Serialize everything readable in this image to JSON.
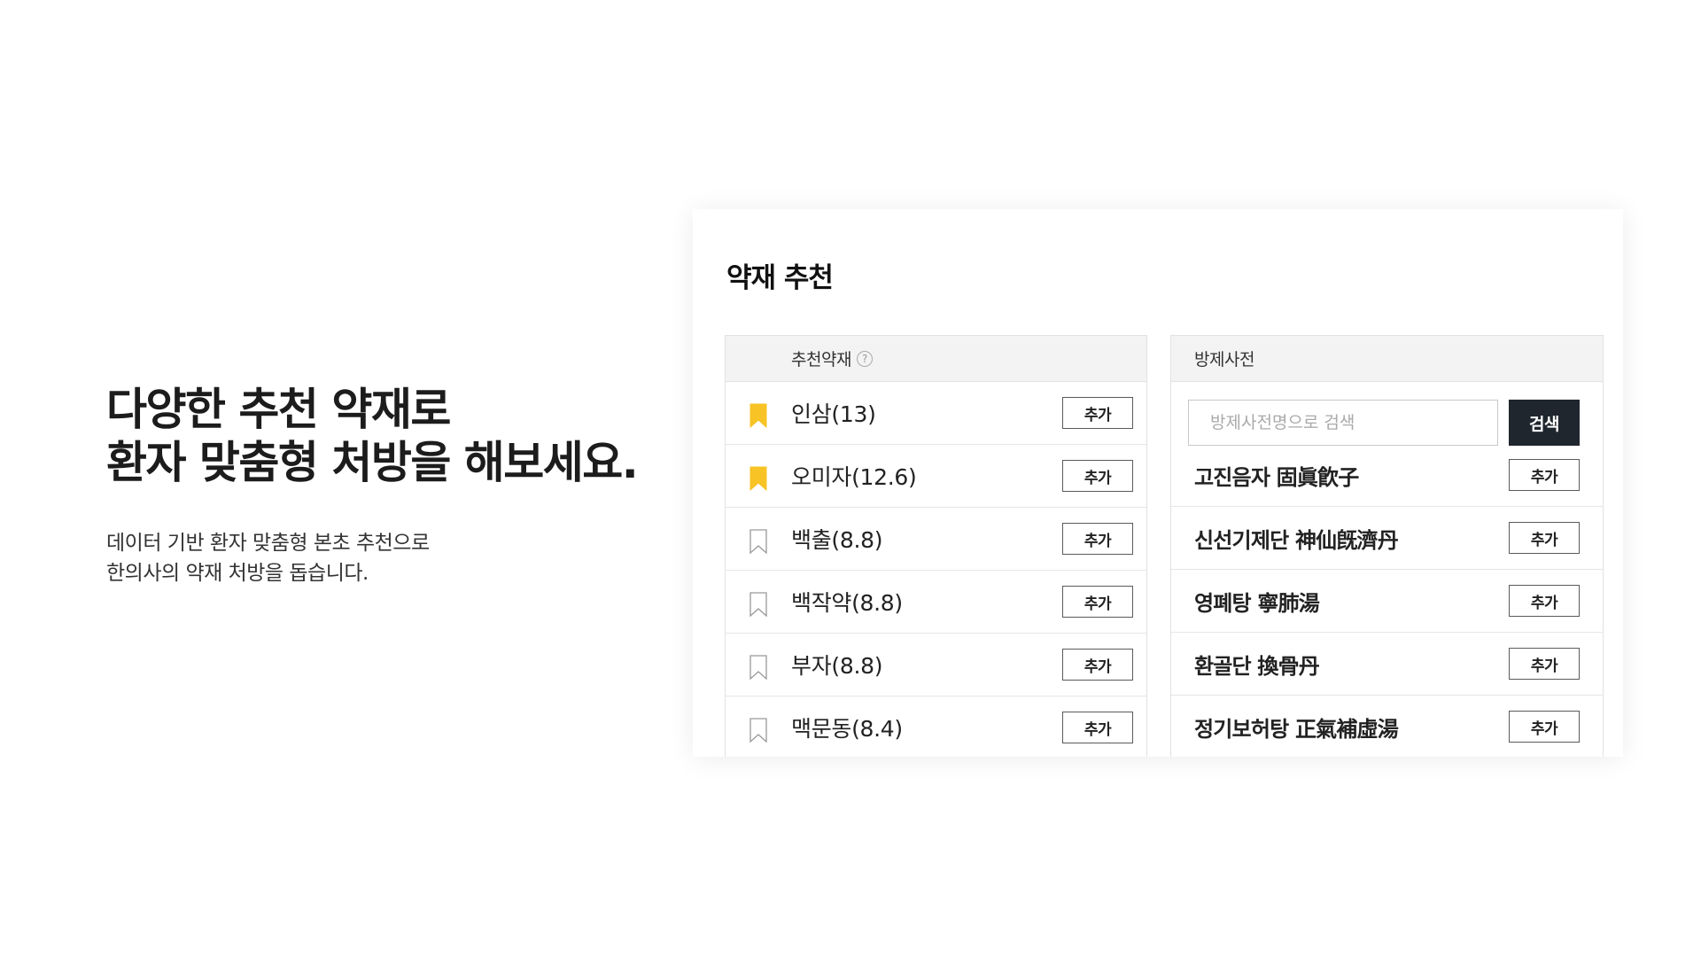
{
  "hero": {
    "title_line1": "다양한 추천 약재로",
    "title_line2": "환자 맞춤형 처방을 해보세요.",
    "desc_line1": "데이터 기반 환자 맞춤형 본초 추천으로",
    "desc_line2": "한의사의 약재 처방을 돕습니다."
  },
  "panel": {
    "title": "약재 추천",
    "recommend": {
      "header": "추천약재",
      "help_icon": "?",
      "items": [
        {
          "label": "인삼(13)",
          "bookmarked": true,
          "button": "추가"
        },
        {
          "label": "오미자(12.6)",
          "bookmarked": true,
          "button": "추가"
        },
        {
          "label": "백출(8.8)",
          "bookmarked": false,
          "button": "추가"
        },
        {
          "label": "백작약(8.8)",
          "bookmarked": false,
          "button": "추가"
        },
        {
          "label": "부자(8.8)",
          "bookmarked": false,
          "button": "추가"
        },
        {
          "label": "맥문동(8.4)",
          "bookmarked": false,
          "button": "추가"
        }
      ]
    },
    "dictionary": {
      "header": "방제사전",
      "search_placeholder": "방제사전명으로 검색",
      "search_value": "",
      "search_button": "검색",
      "items": [
        {
          "label": "고진음자 固眞飮子",
          "button": "추가"
        },
        {
          "label": "신선기제단 神仙旣濟丹",
          "button": "추가"
        },
        {
          "label": "영폐탕 寧肺湯",
          "button": "추가"
        },
        {
          "label": "환골단 換骨丹",
          "button": "추가"
        },
        {
          "label": "정기보허탕 正氣補虛湯",
          "button": "추가"
        }
      ]
    }
  },
  "colors": {
    "bookmark_active": "#f7c325",
    "bookmark_inactive": "#999999",
    "search_button_bg": "#20262d",
    "header_bg": "#f3f3f3"
  },
  "icons": {
    "bookmark_filled": "bookmark-filled-icon",
    "bookmark_outline": "bookmark-outline-icon",
    "help": "help-icon"
  }
}
